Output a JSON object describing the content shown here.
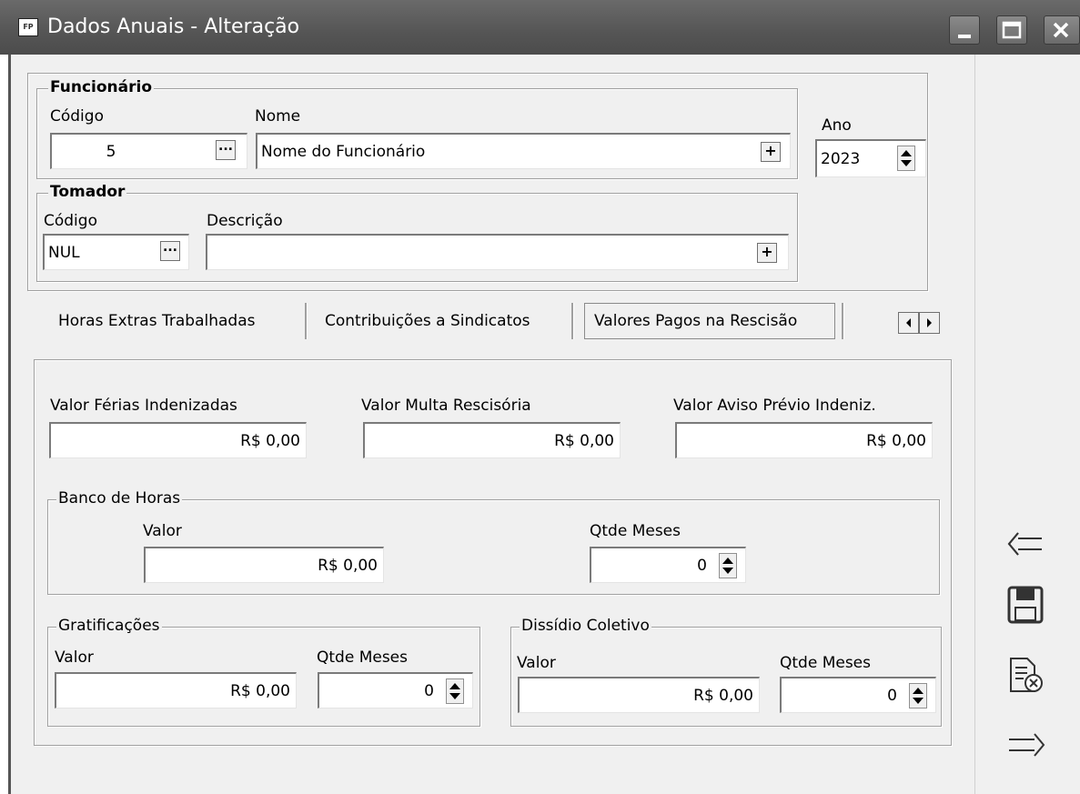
{
  "window": {
    "icon_text": "FP",
    "title": "Dados Anuais - Alteração"
  },
  "funcionario": {
    "legend": "Funcionário",
    "codigo_label": "Código",
    "codigo_value": "5",
    "nome_label": "Nome",
    "nome_value": "Nome do Funcionário"
  },
  "ano": {
    "label": "Ano",
    "value": "2023"
  },
  "tomador": {
    "legend": "Tomador",
    "codigo_label": "Código",
    "codigo_value": "NUL",
    "descricao_label": "Descrição",
    "descricao_value": ""
  },
  "tabs": [
    {
      "label": "Horas Extras Trabalhadas",
      "active": false
    },
    {
      "label": "Contribuições a Sindicatos",
      "active": false
    },
    {
      "label": "Valores Pagos na Rescisão",
      "active": true
    }
  ],
  "rescisao": {
    "ferias_label": "Valor Férias Indenizadas",
    "ferias_value": "R$ 0,00",
    "multa_label": "Valor Multa Rescisória",
    "multa_value": "R$ 0,00",
    "aviso_label": "Valor Aviso Prévio Indeniz.",
    "aviso_value": "R$ 0,00"
  },
  "banco_horas": {
    "legend": "Banco de Horas",
    "valor_label": "Valor",
    "valor_value": "R$ 0,00",
    "meses_label": "Qtde Meses",
    "meses_value": "0"
  },
  "gratificacoes": {
    "legend": "Gratificações",
    "valor_label": "Valor",
    "valor_value": "R$ 0,00",
    "meses_label": "Qtde Meses",
    "meses_value": "0"
  },
  "dissidio": {
    "legend": "Dissídio Coletivo",
    "valor_label": "Valor",
    "valor_value": "R$ 0,00",
    "meses_label": "Qtde Meses",
    "meses_value": "0"
  },
  "toolbar_icons": [
    "back-arrow-icon",
    "save-icon",
    "cancel-document-icon",
    "forward-arrow-icon"
  ]
}
